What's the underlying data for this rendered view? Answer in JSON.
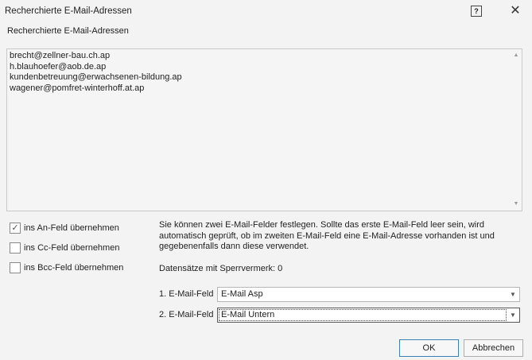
{
  "window": {
    "title": "Recherchierte E-Mail-Adressen",
    "help_glyph": "?",
    "close_glyph": "✕"
  },
  "section_label": "Recherchierte E-Mail-Adressen",
  "emails": [
    "brecht@zellner-bau.ch.ap",
    "h.blauhoefer@aob.de.ap",
    "kundenbetreuung@erwachsenen-bildung.ap",
    "wagener@pomfret-winterhoff.at.ap"
  ],
  "scroll": {
    "up_glyph": "▲",
    "down_glyph": "▼"
  },
  "checkboxes": [
    {
      "label": "ins An-Feld übernehmen",
      "checked": true,
      "glyph": "✓"
    },
    {
      "label": "ins Cc-Feld übernehmen",
      "checked": false,
      "glyph": ""
    },
    {
      "label": "ins Bcc-Feld übernehmen",
      "checked": false,
      "glyph": ""
    }
  ],
  "info_text": "Sie können zwei E-Mail-Felder festlegen. Sollte das erste E-Mail-Feld leer sein, wird automatisch geprüft, ob im zweiten E-Mail-Feld eine E-Mail-Adresse vorhanden ist und gegebenenfalls dann diese verwendet.",
  "sperr_text": "Datensätze mit Sperrvermerk: 0",
  "fields": [
    {
      "label": "1. E-Mail-Feld",
      "value": "E-Mail Asp"
    },
    {
      "label": "2. E-Mail-Feld",
      "value": "E-Mail Untern"
    }
  ],
  "combo_arrow_glyph": "▼",
  "buttons": {
    "ok": "OK",
    "cancel": "Abbrechen"
  },
  "colors": {
    "accent_border": "#3c7fb1",
    "background": "#f3f3f3"
  }
}
